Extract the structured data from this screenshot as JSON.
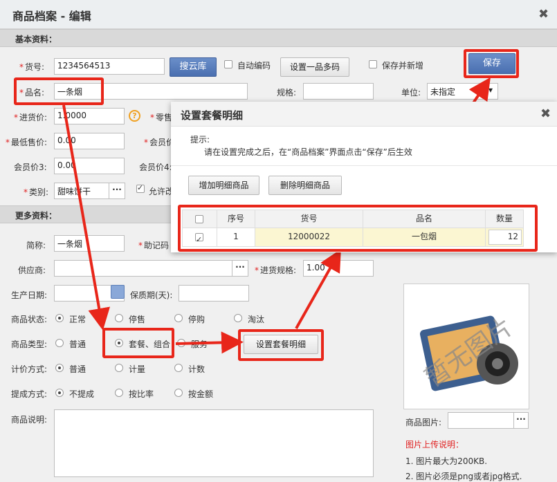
{
  "window": {
    "title": "商品档案 - 编辑",
    "close_glyph": "✖"
  },
  "sections": {
    "basic": "基本资料：",
    "more": "更多资料："
  },
  "basic": {
    "sku_label": "货号:",
    "sku_value": "1234564513",
    "cloud_btn": "搜云库",
    "auto_code_label": "自动编码",
    "multi_code_btn": "设置一品多码",
    "save_new_label": "保存并新增",
    "save_btn": "保存",
    "name_label": "品名:",
    "name_value": "一条烟",
    "spec_label": "规格:",
    "unit_label": "单位:",
    "unit_value": "未指定",
    "purchase_label": "进货价:",
    "purchase_value": "1.0000",
    "retail_label": "零售",
    "min_price_label": "最低售价:",
    "min_price_value": "0.00",
    "member_price_label": "会员价",
    "member3_label": "会员价3:",
    "member3_value": "0.00",
    "member4_label": "会员价4:",
    "category_label": "类别:",
    "category_value": "甜味饼干",
    "allow_label": "允许改"
  },
  "more": {
    "short_label": "简称:",
    "short_value": "一条烟",
    "mnemonic_label": "助记码",
    "supplier_label": "供应商:",
    "purchase_spec_label": "进货规格:",
    "purchase_spec_value": "1.00",
    "prod_date_label": "生产日期:",
    "shelf_life_label": "保质期(天):",
    "status_label": "商品状态:",
    "status_options": [
      "正常",
      "停售",
      "停购",
      "淘汰"
    ],
    "type_label": "商品类型:",
    "type_options": [
      "普通",
      "套餐、组合",
      "服务"
    ],
    "set_combo_btn": "设置套餐明细",
    "pricing_label": "计价方式:",
    "pricing_options": [
      "普通",
      "计量",
      "计数"
    ],
    "commission_label": "提成方式:",
    "commission_options": [
      "不提成",
      "按比率",
      "按金额"
    ],
    "desc_label": "商品说明:",
    "image_label": "商品图片:",
    "image_placeholder_text": "暂无图片",
    "upload_title": "图片上传说明：",
    "upload_rules": [
      "1. 图片最大为200KB.",
      "2. 图片必须是png或者jpg格式."
    ]
  },
  "modal": {
    "title": "设置套餐明细",
    "tip_label": "提示:",
    "tip_text": "请在设置完成之后，在“商品档案”界面点击“保存”后生效",
    "add_btn": "增加明细商品",
    "del_btn": "删除明细商品",
    "columns": [
      "序号",
      "货号",
      "品名",
      "数量"
    ],
    "rows": [
      {
        "index": "1",
        "sku": "12000022",
        "name": "一包烟",
        "qty": "12"
      }
    ]
  },
  "colors": {
    "accent_red": "#e8261a",
    "save_blue": "#4a6fb0",
    "highlight_yellow": "#fbf6d2"
  }
}
